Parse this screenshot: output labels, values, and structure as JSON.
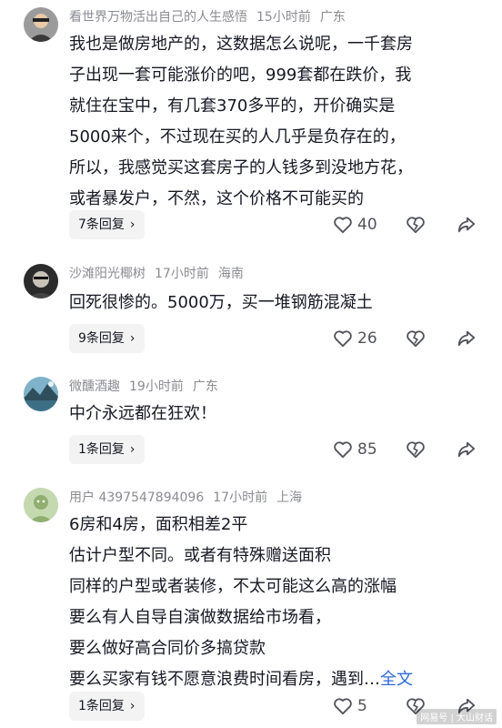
{
  "comments": [
    {
      "username": "看世界万物活出自己的人生感悟",
      "time": "15小时前",
      "location": "广东",
      "lines": [
        "我也是做房地产的，这数据怎么说呢，一千套房",
        "子出现一套可能涨价的吧，999套都在跌价，我",
        "就住在宝中，有几套370多平的，开价确实是",
        "5000来个，不过现在买的人几乎是负存在的，",
        "所以，我感觉买这套房子的人钱多到没地方花，",
        "或者暴发户，不然，这个价格不可能买的"
      ],
      "replies": "7条回复",
      "likes": "40"
    },
    {
      "username": "沙滩阳光椰树",
      "time": "17小时前",
      "location": "海南",
      "lines": [
        "回死很惨的。5000万，买一堆钢筋混凝土"
      ],
      "replies": "9条回复",
      "likes": "26"
    },
    {
      "username": "微醺酒趣",
      "time": "19小时前",
      "location": "广东",
      "lines": [
        "中介永远都在狂欢！"
      ],
      "replies": "1条回复",
      "likes": "85"
    },
    {
      "username": "用户 4397547894096",
      "time": "17小时前",
      "location": "上海",
      "lines": [
        "6房和4房，面积相差2平",
        "估计户型不同。或者有特殊赠送面积",
        "同样的户型或者装修，不太可能这么高的涨幅",
        "要么有人自导自演做数据给市场看，",
        "要么做好高合同价多搞贷款",
        "要么买家有钱不愿意浪费时间看房，遇到…"
      ],
      "full_text_label": "全文",
      "replies": "1条回复",
      "likes": "5"
    }
  ],
  "watermark": "网易号 | 大山财话",
  "colors": {
    "meta": "#8a8b91",
    "text": "#161823",
    "link": "#2f6ad9",
    "reply_bg": "#f3f3f4"
  },
  "icons": [
    "heart-icon",
    "dislike-heart-icon",
    "share-icon",
    "chevron-right-icon"
  ]
}
